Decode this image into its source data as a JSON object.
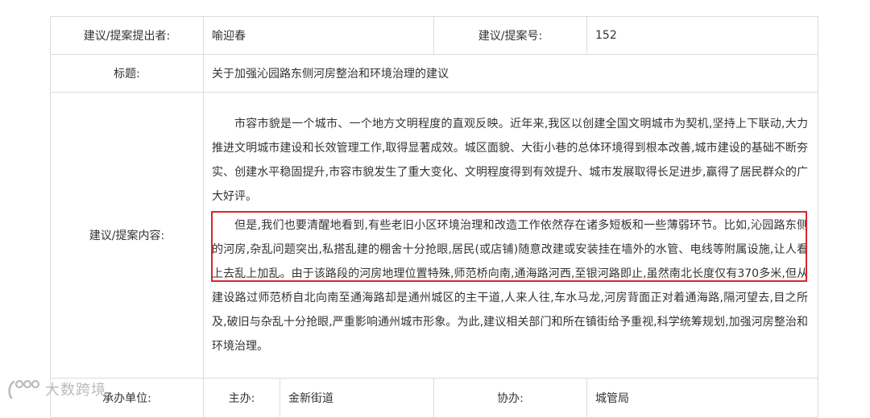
{
  "row1": {
    "proposer_label": "建议/提案提出者:",
    "proposer_value": "喻迎春",
    "number_label": "建议/提案号:",
    "number_value": "152"
  },
  "row2": {
    "title_label": "标题:",
    "title_value": "关于加强沁园路东侧河房整治和环境治理的建议"
  },
  "row3": {
    "content_label": "建议/提案内容:",
    "paragraph1": "市容市貌是一个城市、一个地方文明程度的直观反映。近年来,我区以创建全国文明城市为契机,坚持上下联动,大力推进文明城市建设和长效管理工作,取得显著成效。城区面貌、大街小巷的总体环境得到根本改善,城市建设的基础不断夯实、创建水平稳固提升,市容市貌发生了重大变化、文明程度得到有效提升、城市发展取得长足进步,赢得了居民群众的广大好评。",
    "paragraph2": "但是,我们也要清醒地看到,有些老旧小区环境治理和改造工作依然存在诸多短板和一些薄弱环节。比如,沁园路东侧的河房,杂乱问题突出,私搭乱建的棚舍十分抢眼,居民(或店铺)随意改建或安装挂在墙外的水管、电线等附属设施,让人看上去乱上加乱。由于该路段的河房地理位置特殊,师范桥向南,通海路河西,至银河路即止,虽然南北长度仅有370多米,但从建设路过师范桥自北向南至通海路却是通州城区的主干道,人来人往,车水马龙,河房背面正对着通海路,隔河望去,目之所及,破旧与杂乱十分抢眼,严重影响通州城市形象。为此,建议相关部门和所在镇街给予重视,科学统筹规划,加强河房整治和环境治理。"
  },
  "row4": {
    "handler_label": "承办单位:",
    "main_label": "主办:",
    "main_value": "金新街道",
    "assist_label": "协办:",
    "assist_value": "城管局"
  },
  "watermark": {
    "icon": "logo-icon",
    "text": "大数跨境"
  },
  "colors": {
    "highlight_border": "#d9252b",
    "table_border": "#dcdcdc",
    "text": "#333333"
  }
}
